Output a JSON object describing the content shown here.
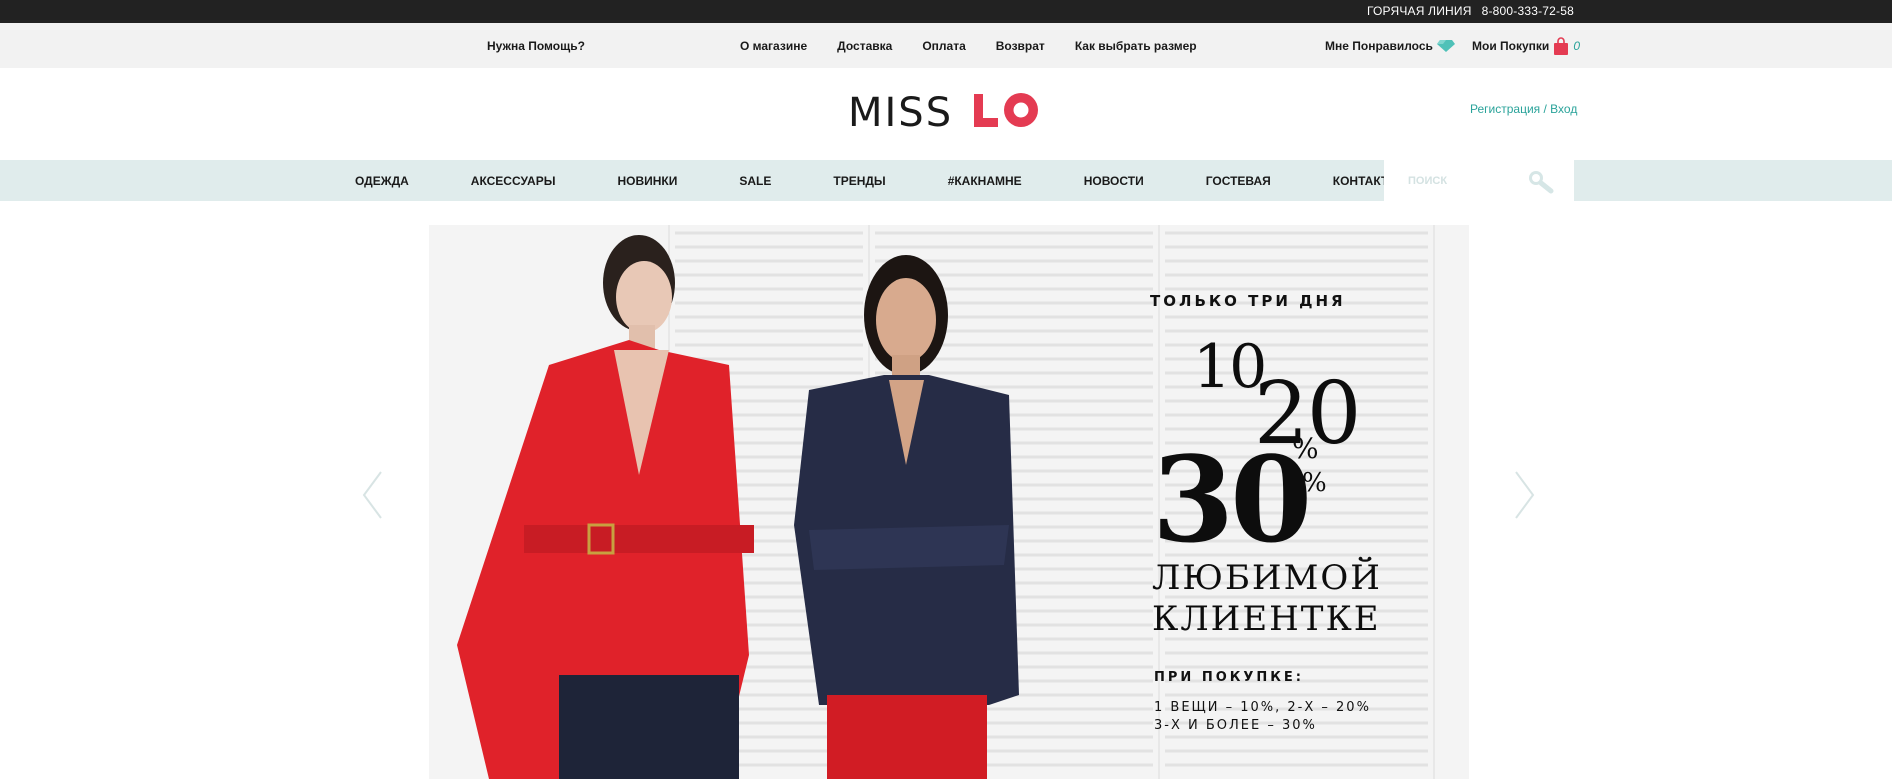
{
  "topbar": {
    "hotline_label": "ГОРЯЧАЯ ЛИНИЯ",
    "hotline_phone": "8-800-333-72-58"
  },
  "utilbar": {
    "help": "Нужна Помощь?",
    "links": [
      "О магазине",
      "Доставка",
      "Оплата",
      "Возврат",
      "Как выбрать размер"
    ],
    "favorites": "Мне Понравилось",
    "cart": "Мои Покупки",
    "cart_count": "0"
  },
  "logo": {
    "text": "MISS LO"
  },
  "auth": {
    "register": "Регистрация",
    "sep": " / ",
    "login": "Вход"
  },
  "mainnav": {
    "items": [
      "ОДЕЖДА",
      "АКСЕССУАРЫ",
      "НОВИНКИ",
      "SALE",
      "ТРЕНДЫ",
      "#КАКНАМНЕ",
      "НОВОСТИ",
      "ГОСТЕВАЯ",
      "КОНТАКТЫ"
    ],
    "search_placeholder": "ПОИСК"
  },
  "banner": {
    "only": "ТОЛЬКО ТРИ ДНЯ",
    "n10": "10",
    "n20": "20",
    "n30": "30",
    "pct": "%",
    "line1": "ЛЮБИМОЙ",
    "line2": "КЛИЕНТКЕ",
    "buy": "ПРИ ПОКУПКЕ:",
    "cond1": "1 ВЕЩИ – 10%, 2-Х – 20%",
    "cond2": "3-Х И БОЛЕЕ – 30%"
  },
  "colors": {
    "accent": "#2aa39a",
    "brand_red": "#e43b52",
    "nav_bg": "#e0ecec"
  }
}
